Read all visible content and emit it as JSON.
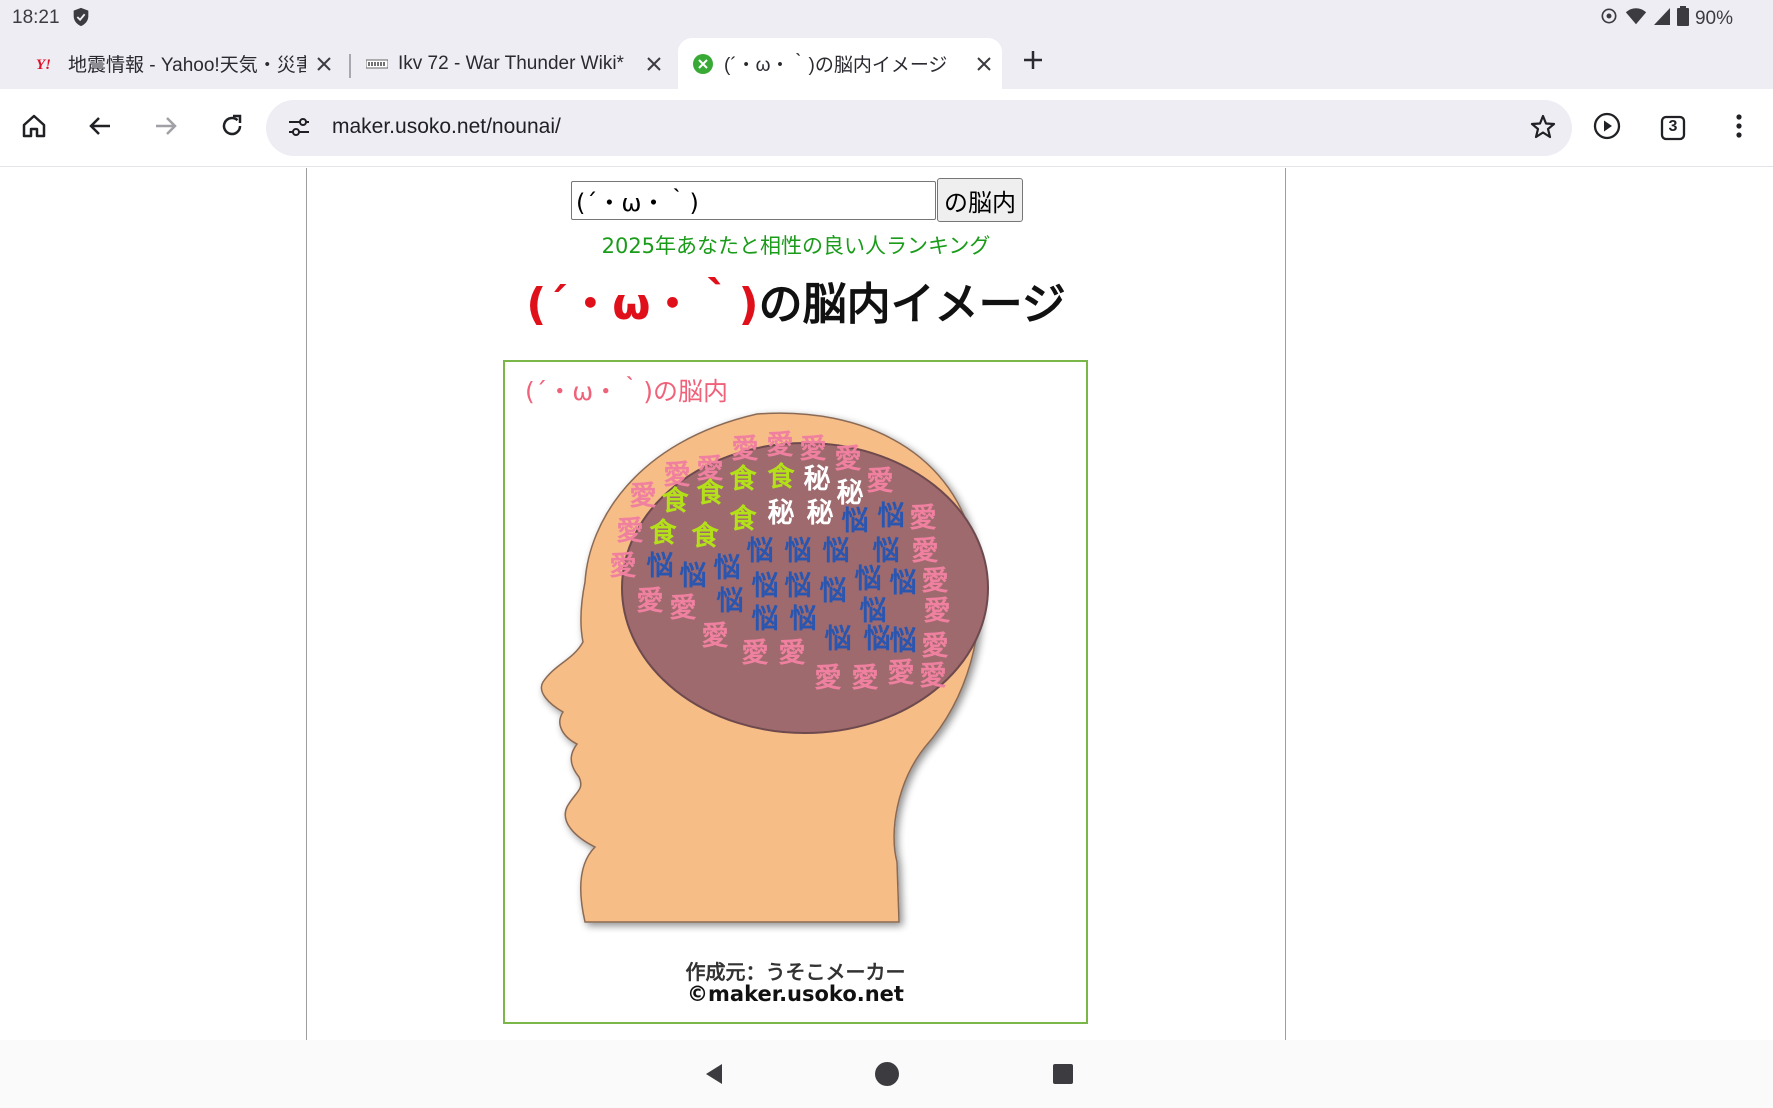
{
  "status_bar": {
    "time": "18:21",
    "battery": "90%"
  },
  "tabs": [
    {
      "title": "地震情報 - Yahoo!天気・災害",
      "favicon": "yahoo-favicon"
    },
    {
      "title": "Ikv 72 - War Thunder Wiki*",
      "favicon": "wiki-favicon"
    },
    {
      "title": "(´・ω・｀)の脳内イメージ",
      "favicon": "usoko-favicon"
    }
  ],
  "tab_count": "3",
  "address_bar": {
    "url": "maker.usoko.net/nounai/"
  },
  "page": {
    "input_value": "(´・ω・｀)",
    "submit_label": "の脳内",
    "ranking_link": "2025年あなたと相性の良い人ランキング",
    "headline_name": "(´・ω・｀)",
    "headline_suffix": "の脳内イメージ",
    "image_title": "(´・ω・｀)の脳内",
    "brain_words": [
      "愛",
      "食",
      "秘",
      "悩"
    ],
    "credit_line1": "作成元：うそこメーカー",
    "credit_line2": "©maker.usoko.net"
  },
  "colors": {
    "love": "#f080a0",
    "food": "#b4e01a",
    "secret": "#ffffff",
    "worry": "#2a56b0",
    "brain": "#9e6a6e",
    "skin": "#f7bd87",
    "headline_name": "#e0101a",
    "ranking_link": "#1a9c1a",
    "frame": "#7ab648"
  }
}
